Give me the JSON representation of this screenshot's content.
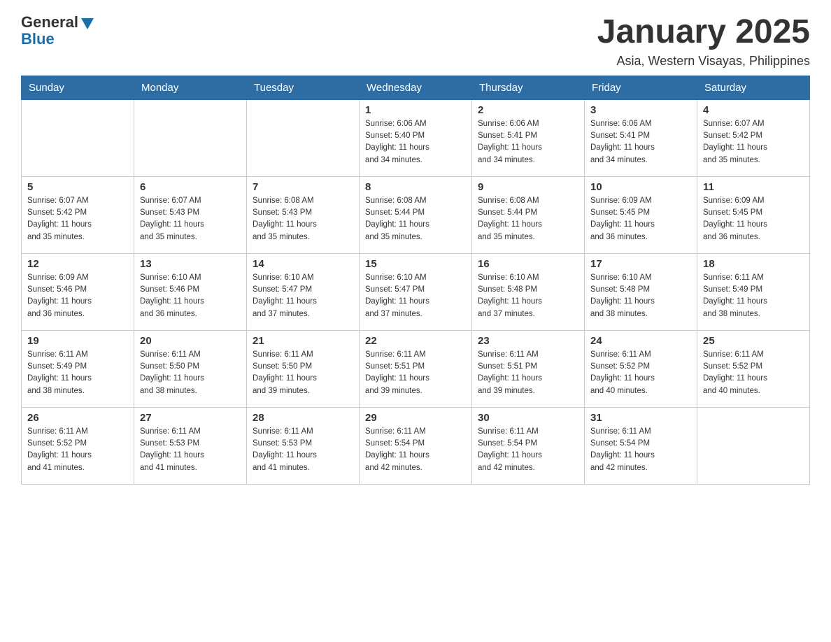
{
  "header": {
    "logo": {
      "general": "General",
      "blue": "Blue"
    },
    "title": "January 2025",
    "subtitle": "Asia, Western Visayas, Philippines"
  },
  "calendar": {
    "days_of_week": [
      "Sunday",
      "Monday",
      "Tuesday",
      "Wednesday",
      "Thursday",
      "Friday",
      "Saturday"
    ],
    "weeks": [
      [
        {
          "day": "",
          "info": ""
        },
        {
          "day": "",
          "info": ""
        },
        {
          "day": "",
          "info": ""
        },
        {
          "day": "1",
          "info": "Sunrise: 6:06 AM\nSunset: 5:40 PM\nDaylight: 11 hours\nand 34 minutes."
        },
        {
          "day": "2",
          "info": "Sunrise: 6:06 AM\nSunset: 5:41 PM\nDaylight: 11 hours\nand 34 minutes."
        },
        {
          "day": "3",
          "info": "Sunrise: 6:06 AM\nSunset: 5:41 PM\nDaylight: 11 hours\nand 34 minutes."
        },
        {
          "day": "4",
          "info": "Sunrise: 6:07 AM\nSunset: 5:42 PM\nDaylight: 11 hours\nand 35 minutes."
        }
      ],
      [
        {
          "day": "5",
          "info": "Sunrise: 6:07 AM\nSunset: 5:42 PM\nDaylight: 11 hours\nand 35 minutes."
        },
        {
          "day": "6",
          "info": "Sunrise: 6:07 AM\nSunset: 5:43 PM\nDaylight: 11 hours\nand 35 minutes."
        },
        {
          "day": "7",
          "info": "Sunrise: 6:08 AM\nSunset: 5:43 PM\nDaylight: 11 hours\nand 35 minutes."
        },
        {
          "day": "8",
          "info": "Sunrise: 6:08 AM\nSunset: 5:44 PM\nDaylight: 11 hours\nand 35 minutes."
        },
        {
          "day": "9",
          "info": "Sunrise: 6:08 AM\nSunset: 5:44 PM\nDaylight: 11 hours\nand 35 minutes."
        },
        {
          "day": "10",
          "info": "Sunrise: 6:09 AM\nSunset: 5:45 PM\nDaylight: 11 hours\nand 36 minutes."
        },
        {
          "day": "11",
          "info": "Sunrise: 6:09 AM\nSunset: 5:45 PM\nDaylight: 11 hours\nand 36 minutes."
        }
      ],
      [
        {
          "day": "12",
          "info": "Sunrise: 6:09 AM\nSunset: 5:46 PM\nDaylight: 11 hours\nand 36 minutes."
        },
        {
          "day": "13",
          "info": "Sunrise: 6:10 AM\nSunset: 5:46 PM\nDaylight: 11 hours\nand 36 minutes."
        },
        {
          "day": "14",
          "info": "Sunrise: 6:10 AM\nSunset: 5:47 PM\nDaylight: 11 hours\nand 37 minutes."
        },
        {
          "day": "15",
          "info": "Sunrise: 6:10 AM\nSunset: 5:47 PM\nDaylight: 11 hours\nand 37 minutes."
        },
        {
          "day": "16",
          "info": "Sunrise: 6:10 AM\nSunset: 5:48 PM\nDaylight: 11 hours\nand 37 minutes."
        },
        {
          "day": "17",
          "info": "Sunrise: 6:10 AM\nSunset: 5:48 PM\nDaylight: 11 hours\nand 38 minutes."
        },
        {
          "day": "18",
          "info": "Sunrise: 6:11 AM\nSunset: 5:49 PM\nDaylight: 11 hours\nand 38 minutes."
        }
      ],
      [
        {
          "day": "19",
          "info": "Sunrise: 6:11 AM\nSunset: 5:49 PM\nDaylight: 11 hours\nand 38 minutes."
        },
        {
          "day": "20",
          "info": "Sunrise: 6:11 AM\nSunset: 5:50 PM\nDaylight: 11 hours\nand 38 minutes."
        },
        {
          "day": "21",
          "info": "Sunrise: 6:11 AM\nSunset: 5:50 PM\nDaylight: 11 hours\nand 39 minutes."
        },
        {
          "day": "22",
          "info": "Sunrise: 6:11 AM\nSunset: 5:51 PM\nDaylight: 11 hours\nand 39 minutes."
        },
        {
          "day": "23",
          "info": "Sunrise: 6:11 AM\nSunset: 5:51 PM\nDaylight: 11 hours\nand 39 minutes."
        },
        {
          "day": "24",
          "info": "Sunrise: 6:11 AM\nSunset: 5:52 PM\nDaylight: 11 hours\nand 40 minutes."
        },
        {
          "day": "25",
          "info": "Sunrise: 6:11 AM\nSunset: 5:52 PM\nDaylight: 11 hours\nand 40 minutes."
        }
      ],
      [
        {
          "day": "26",
          "info": "Sunrise: 6:11 AM\nSunset: 5:52 PM\nDaylight: 11 hours\nand 41 minutes."
        },
        {
          "day": "27",
          "info": "Sunrise: 6:11 AM\nSunset: 5:53 PM\nDaylight: 11 hours\nand 41 minutes."
        },
        {
          "day": "28",
          "info": "Sunrise: 6:11 AM\nSunset: 5:53 PM\nDaylight: 11 hours\nand 41 minutes."
        },
        {
          "day": "29",
          "info": "Sunrise: 6:11 AM\nSunset: 5:54 PM\nDaylight: 11 hours\nand 42 minutes."
        },
        {
          "day": "30",
          "info": "Sunrise: 6:11 AM\nSunset: 5:54 PM\nDaylight: 11 hours\nand 42 minutes."
        },
        {
          "day": "31",
          "info": "Sunrise: 6:11 AM\nSunset: 5:54 PM\nDaylight: 11 hours\nand 42 minutes."
        },
        {
          "day": "",
          "info": ""
        }
      ]
    ]
  }
}
